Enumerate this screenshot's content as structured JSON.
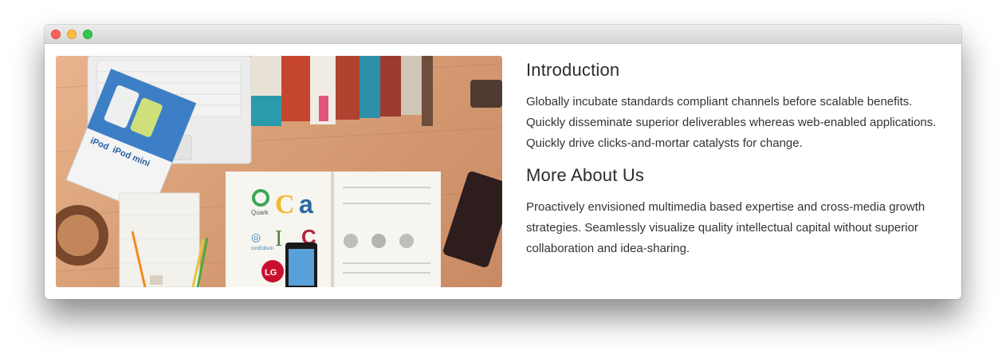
{
  "window": {
    "controls": [
      "close",
      "minimize",
      "maximize"
    ],
    "colors": {
      "close": "#fc605c",
      "minimize": "#fdbc40",
      "maximize": "#34c84a"
    }
  },
  "image": {
    "description_icon": "desk-workspace-photo",
    "booklet_text_1": "iPod",
    "booklet_text_2": "iPod mini",
    "logo_quark": "Quark",
    "logo_coned": "conEdison"
  },
  "sections": [
    {
      "heading": "Introduction",
      "lines": [
        "Globally incubate standards compliant channels before scalable benefits.",
        "Quickly disseminate superior deliverables whereas web-enabled applications.",
        "Quickly drive clicks-and-mortar catalysts for change."
      ]
    },
    {
      "heading": "More About Us",
      "lines": [
        "Proactively envisioned multimedia based expertise and cross-media growth",
        "strategies. Seamlessly visualize quality intellectual capital without superior",
        "collaboration and idea-sharing."
      ]
    }
  ]
}
